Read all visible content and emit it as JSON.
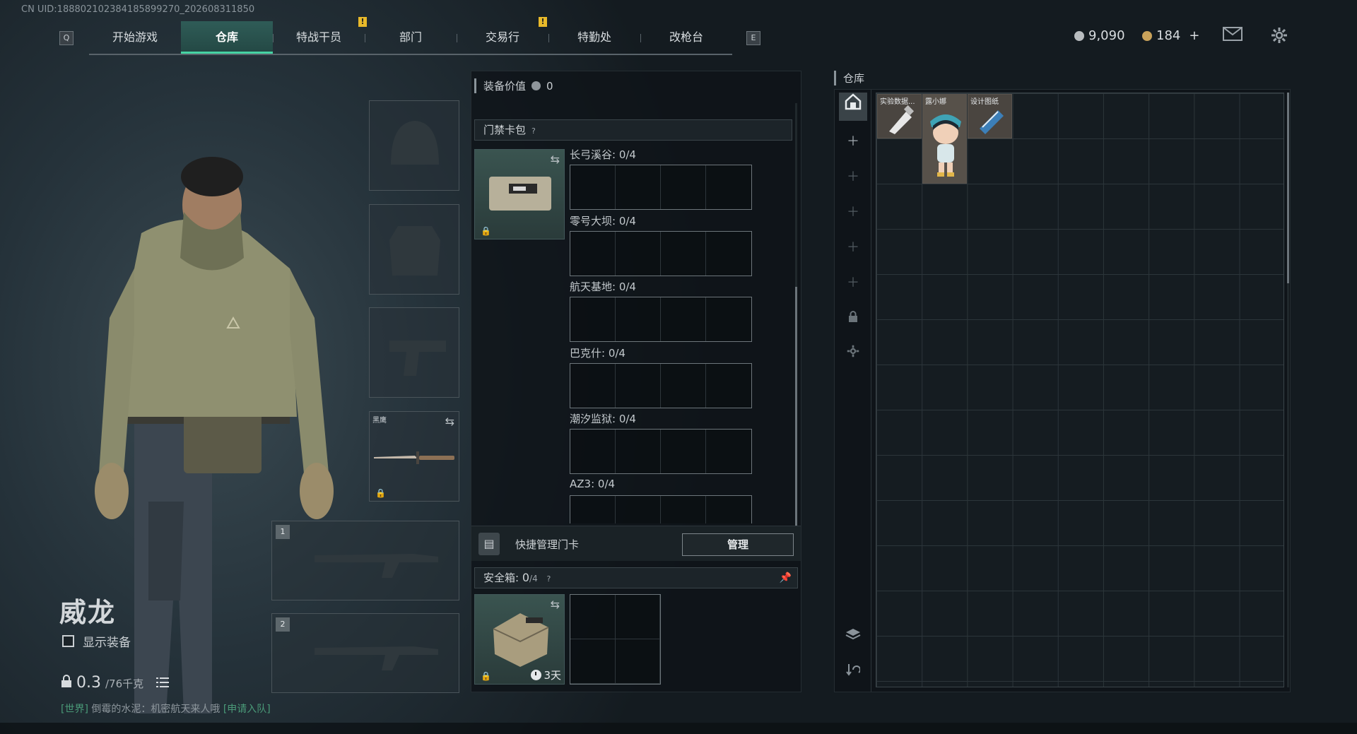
{
  "uid": "CN UID:1888021023841858992​70_202608311850",
  "nav": {
    "key_left": "Q",
    "key_right": "E",
    "tabs": [
      {
        "label": "开始游戏",
        "active": false,
        "alert": false
      },
      {
        "label": "仓库",
        "active": true,
        "alert": false
      },
      {
        "label": "特战干员",
        "active": false,
        "alert": true
      },
      {
        "label": "部门",
        "active": false,
        "alert": false
      },
      {
        "label": "交易行",
        "active": false,
        "alert": false
      },
      {
        "label": "特勤处",
        "active": false,
        "alert": true
      },
      {
        "label": "改枪台",
        "active": false,
        "alert": false
      }
    ],
    "alert_mark": "!"
  },
  "currency": {
    "silver": "9,090",
    "gold": "184",
    "plus": "+"
  },
  "icons": {
    "mail": "mail-icon",
    "settings": "gear-icon"
  },
  "character": {
    "name": "威龙",
    "show_equipment_label": "显示装备",
    "weight_value": "0.3",
    "weight_max": "/76千克"
  },
  "chat": {
    "channel": "[世界]",
    "text": "倒霉的水泥：机密航天来人哦",
    "join": "[申请入队]"
  },
  "equipment": {
    "melee_label": "黑鹰",
    "weapon_slot_1": "1",
    "weapon_slot_2": "2"
  },
  "middle": {
    "value_label": "装备价值",
    "value": "0",
    "keycard_section": "门禁卡包",
    "help": "?",
    "regions": [
      {
        "name": "长弓溪谷: 0/4"
      },
      {
        "name": "零号大坝: 0/4"
      },
      {
        "name": "航天基地: 0/4"
      },
      {
        "name": "巴克什: 0/4"
      },
      {
        "name": "潮汐监狱: 0/4"
      },
      {
        "name": "AZ3: 0/4"
      }
    ],
    "quick_manage_label": "快捷管理门卡",
    "manage_button": "管理",
    "safe_label": "安全箱:",
    "safe_count": "0",
    "safe_cap": "/4",
    "safe_timer": "3天"
  },
  "warehouse": {
    "title": "仓库",
    "items": [
      {
        "name": "实验数据..."
      },
      {
        "name": "露小娜"
      },
      {
        "name": "设计图纸"
      }
    ]
  },
  "colors": {
    "accent": "#46d3a4",
    "alert": "#e8b92a",
    "item_bg": "#4a4540"
  }
}
